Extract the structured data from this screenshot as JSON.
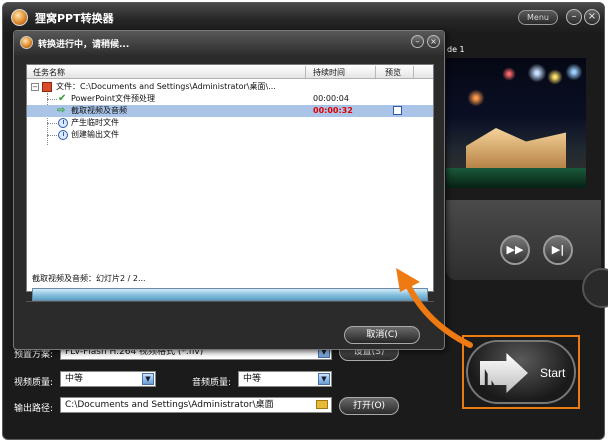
{
  "app": {
    "title": "狸窝PPT转换器",
    "menu_label": "Menu",
    "min_label": "–",
    "close_label": "×"
  },
  "preview": {
    "slide_label": "de 1"
  },
  "form": {
    "preset_label": "预置方案:",
    "preset_value": "FLV-Flash H.264 视频格式 (*.flv)",
    "settings_button": "设置(S)",
    "video_quality_label": "视频质量:",
    "video_quality_value": "中等",
    "audio_quality_label": "音频质量:",
    "audio_quality_value": "中等",
    "output_path_label": "输出路径:",
    "output_path_value": "C:\\Documents and Settings\\Administrator\\桌面",
    "open_button": "打开(O)",
    "start_label": "Start"
  },
  "dialog": {
    "title": "转换进行中，请稍候...",
    "columns": {
      "task": "任务名称",
      "elapsed": "持续时间",
      "preview": "预览"
    },
    "rows": [
      {
        "label": "文件：C:\\Documents and Settings\\Administrator\\桌面\\...",
        "time": "",
        "icon": "ppt-file-icon"
      },
      {
        "label": "PowerPoint文件预处理",
        "time": "00:00:04",
        "icon": "check-icon"
      },
      {
        "label": "截取视频及音频",
        "time": "00:00:32",
        "icon": "arrow-right-icon"
      },
      {
        "label": "产生临时文件",
        "time": "",
        "icon": "clock-icon"
      },
      {
        "label": "创建输出文件",
        "time": "",
        "icon": "clock-icon"
      }
    ],
    "status": "截取视频及音频：幻灯片2 / 2...",
    "progress_percent": 100,
    "cancel_button": "取消(C)"
  },
  "colors": {
    "highlight": "#aac4e8",
    "running_time": "#e00000",
    "accent_orange": "#f07a12"
  }
}
